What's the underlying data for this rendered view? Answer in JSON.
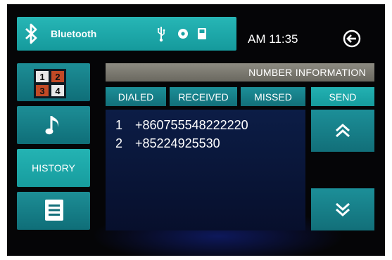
{
  "topbar": {
    "label": "Bluetooth",
    "icons": [
      "bluetooth-icon",
      "usb-icon",
      "disc-icon",
      "sd-card-icon"
    ]
  },
  "clock": "AM 11:35",
  "sidebar": {
    "items": [
      {
        "type": "grid",
        "cells": [
          "1",
          "2",
          "3",
          "4"
        ]
      },
      {
        "type": "icon",
        "icon": "music-note-icon"
      },
      {
        "type": "text",
        "label": "HISTORY",
        "active": true
      },
      {
        "type": "icon",
        "icon": "list-icon"
      }
    ]
  },
  "header": {
    "title": "NUMBER INFORMATION"
  },
  "tabs": [
    {
      "label": "DIALED"
    },
    {
      "label": "RECEIVED"
    },
    {
      "label": "MISSED"
    }
  ],
  "send_label": "SEND",
  "entries": [
    {
      "index": "1",
      "number": "+8607555482222​20"
    },
    {
      "index": "2",
      "number": "+85224925530"
    }
  ],
  "colors": {
    "accent": "#1fa8aa",
    "dark_teal": "#136f7a",
    "panel": "#0a1838",
    "header": "#7b796f"
  }
}
